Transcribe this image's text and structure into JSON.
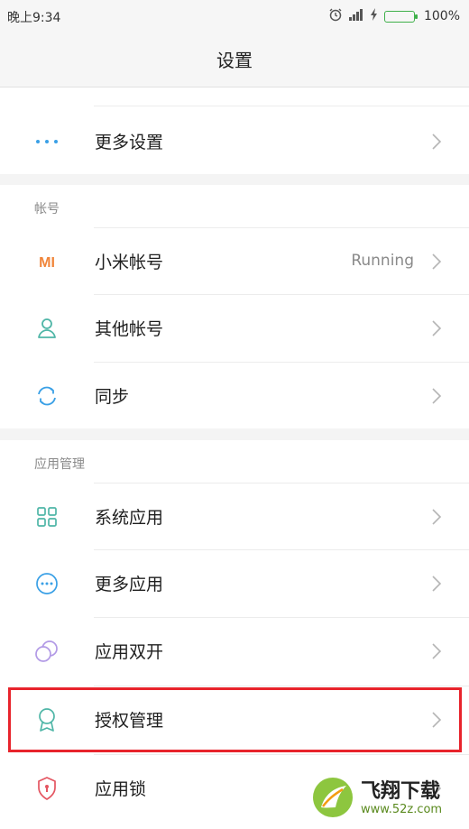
{
  "status_bar": {
    "time": "晚上9:34",
    "battery": "100%"
  },
  "title": "设置",
  "top_section": {
    "items": [
      {
        "label": "更多设置"
      }
    ]
  },
  "account_section": {
    "header": "帐号",
    "items": [
      {
        "label": "小米帐号",
        "value": "Running"
      },
      {
        "label": "其他帐号"
      },
      {
        "label": "同步"
      }
    ]
  },
  "apps_section": {
    "header": "应用管理",
    "items": [
      {
        "label": "系统应用"
      },
      {
        "label": "更多应用"
      },
      {
        "label": "应用双开"
      },
      {
        "label": "授权管理"
      },
      {
        "label": "应用锁"
      }
    ]
  },
  "mi_logo_text": "MI",
  "watermark": {
    "brand": "飞翔下载",
    "url": "www.52z.com"
  },
  "colors": {
    "highlight": "#e8242c",
    "mi_orange": "#f0853a",
    "teal": "#4fb6a7",
    "blue": "#3aa0e6",
    "purple": "#b29ae6",
    "red": "#e45561"
  }
}
